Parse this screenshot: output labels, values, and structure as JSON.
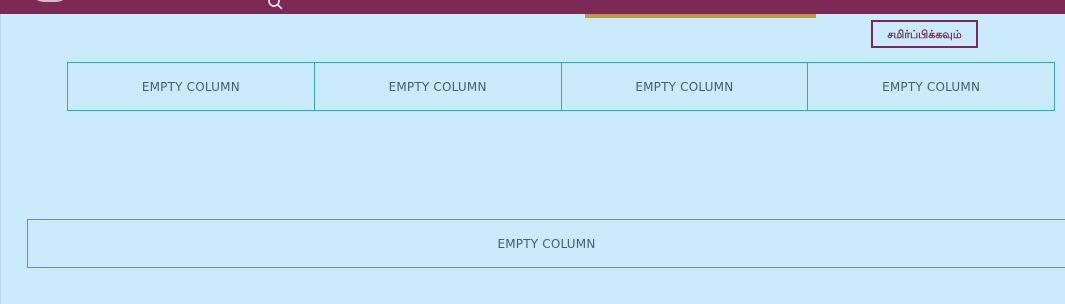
{
  "header": {
    "submit_button_label": "சமிர்ப்பிக்கவும்",
    "brand_color": "#7c2a55",
    "accent_color": "#b79d4a"
  },
  "row1": {
    "columns": [
      {
        "label": "EMPTY COLUMN"
      },
      {
        "label": "EMPTY COLUMN"
      },
      {
        "label": "EMPTY COLUMN"
      },
      {
        "label": "EMPTY COLUMN"
      }
    ]
  },
  "row2": {
    "columns": [
      {
        "label": "EMPTY COLUMN"
      }
    ]
  },
  "icons": {
    "search": "search-icon"
  }
}
